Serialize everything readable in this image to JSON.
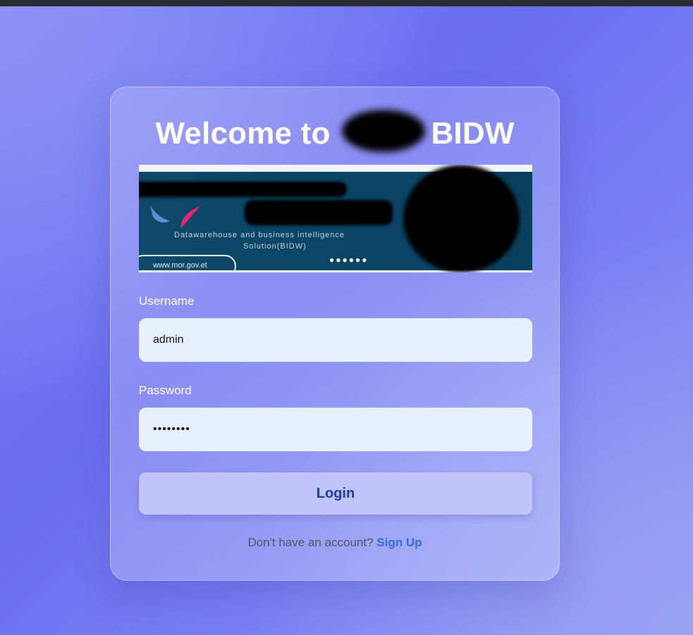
{
  "card": {
    "title_prefix": "Welcome to",
    "title_suffix": "BIDW"
  },
  "banner": {
    "tagline_line1": "Datawarehouse and business intelligence",
    "tagline_line2": "Solution(BIDW)",
    "dots": "●●●●●●",
    "website": "www.mor.gov.et",
    "colors": {
      "background": "#0d4868",
      "logo_blue": "#5b8fd6",
      "logo_pink": "#e8236f"
    }
  },
  "form": {
    "username_label": "Username",
    "username_value": "admin",
    "password_label": "Password",
    "password_value": "••••••••",
    "login_label": "Login"
  },
  "footer": {
    "prompt": "Don't have an account?",
    "signup_label": "Sign Up"
  },
  "colors": {
    "accent_link": "#2f6be6",
    "button_bg": "#c0c4fb",
    "button_text": "#1e3a9e",
    "input_bg": "#e8effd"
  }
}
